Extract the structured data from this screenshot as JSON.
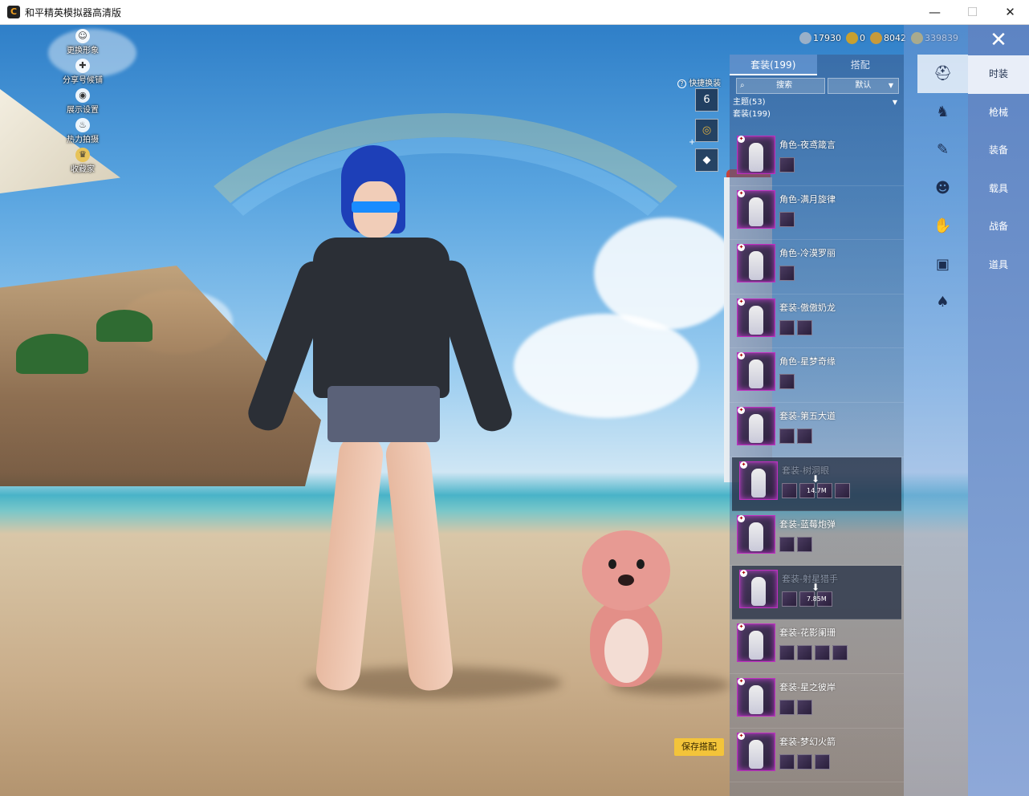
{
  "window": {
    "title": "和平精英模拟器高清版",
    "controls": {
      "minimize": "—",
      "maximize": "☐",
      "close": "✕"
    }
  },
  "left_menu": [
    {
      "label": "更换形象",
      "icon": "avatar-icon"
    },
    {
      "label": "分享号候铺",
      "icon": "share-icon"
    },
    {
      "label": "展示设置",
      "icon": "eye-icon"
    },
    {
      "label": "热力拍摄",
      "icon": "fire-icon"
    },
    {
      "label": "收藏家",
      "icon": "collector-icon"
    }
  ],
  "currency": [
    {
      "value": "17930",
      "color": "#9ab0c8"
    },
    {
      "value": "0",
      "color": "#c8a030"
    },
    {
      "value": "8042",
      "color": "#c79a3a"
    },
    {
      "value": "339839",
      "color": "#f0c23a"
    }
  ],
  "quick_change": {
    "label": "快捷换装",
    "help_icon": "?",
    "slot_number": "6"
  },
  "save_button": "保存搭配",
  "panel": {
    "tabs": [
      {
        "label": "套装(199)"
      },
      {
        "label": "搭配"
      }
    ],
    "search": {
      "label": "搜索"
    },
    "sort": {
      "label": "默认"
    },
    "categories": [
      {
        "label": "主题(53)"
      },
      {
        "label": "套装(199)"
      }
    ]
  },
  "items": [
    {
      "name": "角色-夜鸢箴言",
      "subs": 1,
      "download": false
    },
    {
      "name": "角色-满月旋律",
      "subs": 1,
      "download": false
    },
    {
      "name": "角色-冷漠罗丽",
      "subs": 1,
      "download": false
    },
    {
      "name": "套装-傲傲奶龙",
      "subs": 2,
      "download": false
    },
    {
      "name": "角色-星梦奇缘",
      "subs": 1,
      "download": false
    },
    {
      "name": "套装-第五大道",
      "subs": 2,
      "download": false
    },
    {
      "name": "套装-树洞眼",
      "subs": 4,
      "download": true,
      "size": "14.7M"
    },
    {
      "name": "套装-蓝莓炮弹",
      "subs": 2,
      "download": false
    },
    {
      "name": "套装-射星猎手",
      "subs": 3,
      "download": true,
      "size": "7.85M"
    },
    {
      "name": "套装-花影阑珊",
      "subs": 4,
      "download": false
    },
    {
      "name": "套装-星之彼岸",
      "subs": 2,
      "download": false
    },
    {
      "name": "套装-梦幻火箭",
      "subs": 3,
      "download": false
    }
  ],
  "right_nav_icons": [
    "hat-icon",
    "armor-icon",
    "mask-icon",
    "face-icon",
    "glove-icon",
    "backpack-icon",
    "shoe-icon"
  ],
  "side_categories": [
    {
      "label": "时装"
    },
    {
      "label": "枪械"
    },
    {
      "label": "装备"
    },
    {
      "label": "载具"
    },
    {
      "label": "战备"
    },
    {
      "label": "道具"
    }
  ],
  "close_icon": "✕"
}
